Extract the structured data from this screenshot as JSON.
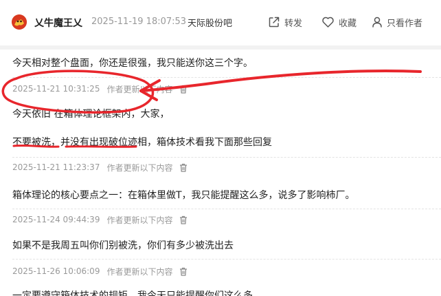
{
  "header": {
    "username": "乂牛魔王乂",
    "post_time": "2025-11-19 18:07:53",
    "forum_name": "天际股份吧",
    "actions": {
      "share_label": "转发",
      "favorite_label": "收藏",
      "author_only_label": "只看作者"
    },
    "icons": {
      "avatar": "avatar-image",
      "share": "share-icon",
      "favorite": "heart-icon",
      "author_only": "person-icon"
    }
  },
  "posts": [
    {
      "lines": [
        "今天相对整个盘面，你还是很强，我只能送你这三个字。"
      ]
    },
    {
      "timestamp": "2025-11-21 10:31:25",
      "update_label": "作者更新以下内容",
      "lines": [
        "今天依旧 在箱体理论框架内，大家，",
        "不要被洗，并没有出现破位迹相，箱体技术看我下面那些回复"
      ]
    },
    {
      "timestamp": "2025-11-21 11:23:37",
      "update_label": "作者更新以下内容",
      "lines": [
        "箱体理论的核心要点之一：在箱体里做T，我只能提醒这么多，说多了影响柿厂。"
      ]
    },
    {
      "timestamp": "2025-11-24 09:44:39",
      "update_label": "作者更新以下内容",
      "lines": [
        "如果不是我周五叫你们别被洗，你们有多少被洗出去"
      ]
    },
    {
      "timestamp": "2025-11-26 10:06:09",
      "update_label": "作者更新以下内容",
      "lines": [
        "一定要遵守箱体技术的规矩，我今天只能提醒你们这么多"
      ]
    }
  ],
  "colors": {
    "annotation_red": "#e8262c",
    "meta_gray": "#999999",
    "text": "#222222"
  }
}
